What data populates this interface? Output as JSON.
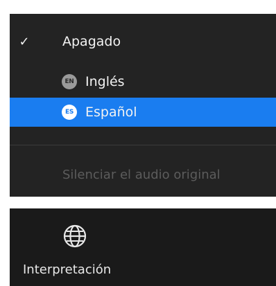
{
  "menu": {
    "items": [
      {
        "label": "Apagado",
        "checked": true,
        "badge": ""
      },
      {
        "label": "Inglés",
        "checked": false,
        "badge": "EN"
      },
      {
        "label": "Español",
        "checked": false,
        "badge": "ES",
        "highlighted": true
      }
    ],
    "check_glyph": "✓",
    "mute_original_label": "Silenciar el audio original"
  },
  "toolbar": {
    "interpretation_label": "Interpretación",
    "interpretation_icon": "globe-icon"
  },
  "colors": {
    "menu_bg": "#232323",
    "highlight": "#1a7df0",
    "toolbar_bg": "#1a1a1a",
    "disabled_text": "#5c5c5c"
  }
}
